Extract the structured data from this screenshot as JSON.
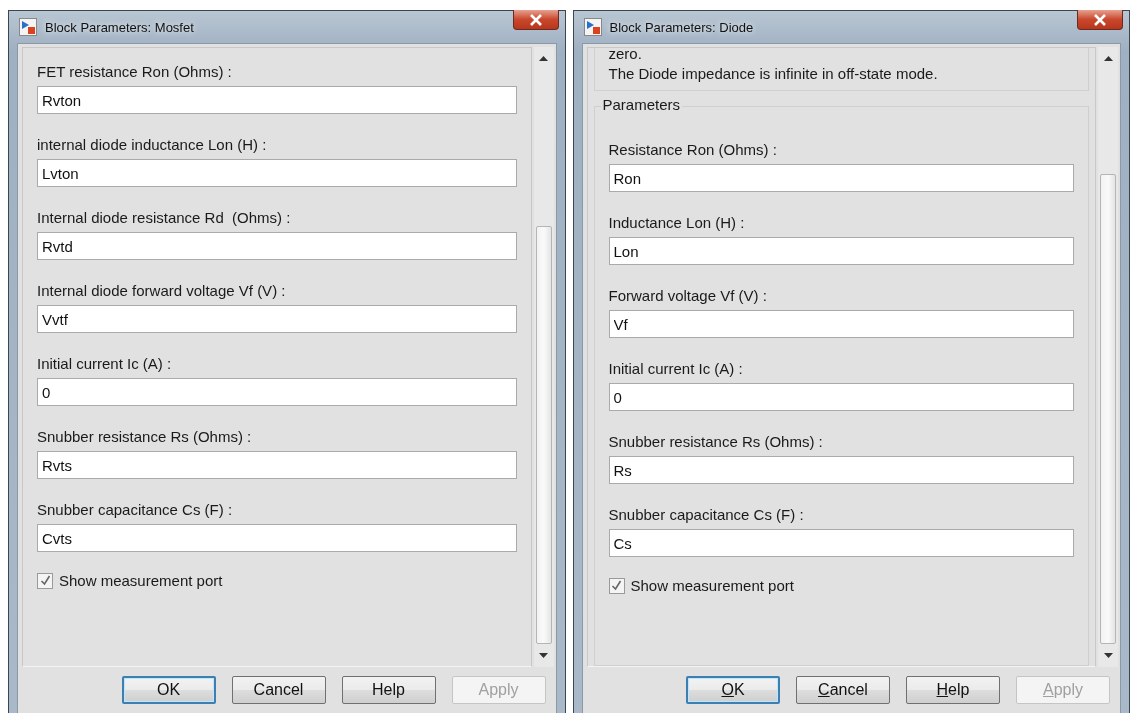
{
  "dialogs": [
    {
      "title": "Block Parameters: Mosfet",
      "mnemonics": false,
      "parameters": [
        {
          "label": "FET resistance Ron (Ohms) :",
          "value": "Rvton"
        },
        {
          "label": "internal diode inductance Lon (H) :",
          "value": "Lvton"
        },
        {
          "label": "Internal diode resistance Rd  (Ohms) :",
          "value": "Rvtd"
        },
        {
          "label": "Internal diode forward voltage Vf (V) :",
          "value": "Vvtf"
        },
        {
          "label": "Initial current Ic (A) :",
          "value": "0"
        },
        {
          "label": "Snubber resistance Rs (Ohms) :",
          "value": "Rvts"
        },
        {
          "label": "Snubber capacitance Cs (F) :",
          "value": "Cvts"
        }
      ],
      "checkbox": {
        "label": "Show measurement port",
        "checked": true
      },
      "buttons": [
        {
          "label": "OK",
          "default": true,
          "disabled": false
        },
        {
          "label": "Cancel",
          "default": false,
          "disabled": false
        },
        {
          "label": "Help",
          "default": false,
          "disabled": false
        },
        {
          "label": "Apply",
          "default": false,
          "disabled": true
        }
      ]
    },
    {
      "title": "Block Parameters: Diode",
      "mnemonics": true,
      "description": [
        "zero.",
        "The Diode impedance is infinite in off-state mode."
      ],
      "group_title": "Parameters",
      "parameters": [
        {
          "label": "Resistance Ron (Ohms) :",
          "value": "Ron"
        },
        {
          "label": "Inductance Lon (H) :",
          "value": "Lon"
        },
        {
          "label": "Forward voltage Vf (V) :",
          "value": "Vf"
        },
        {
          "label": "Initial current Ic (A) :",
          "value": "0"
        },
        {
          "label": "Snubber resistance Rs (Ohms) :",
          "value": "Rs"
        },
        {
          "label": "Snubber capacitance Cs (F) :",
          "value": "Cs"
        }
      ],
      "checkbox": {
        "label": "Show measurement port",
        "checked": true
      },
      "buttons": [
        {
          "label": "OK",
          "default": true,
          "disabled": false
        },
        {
          "label": "Cancel",
          "default": false,
          "disabled": false
        },
        {
          "label": "Help",
          "default": false,
          "disabled": false
        },
        {
          "label": "Apply",
          "default": false,
          "disabled": true
        }
      ]
    }
  ]
}
